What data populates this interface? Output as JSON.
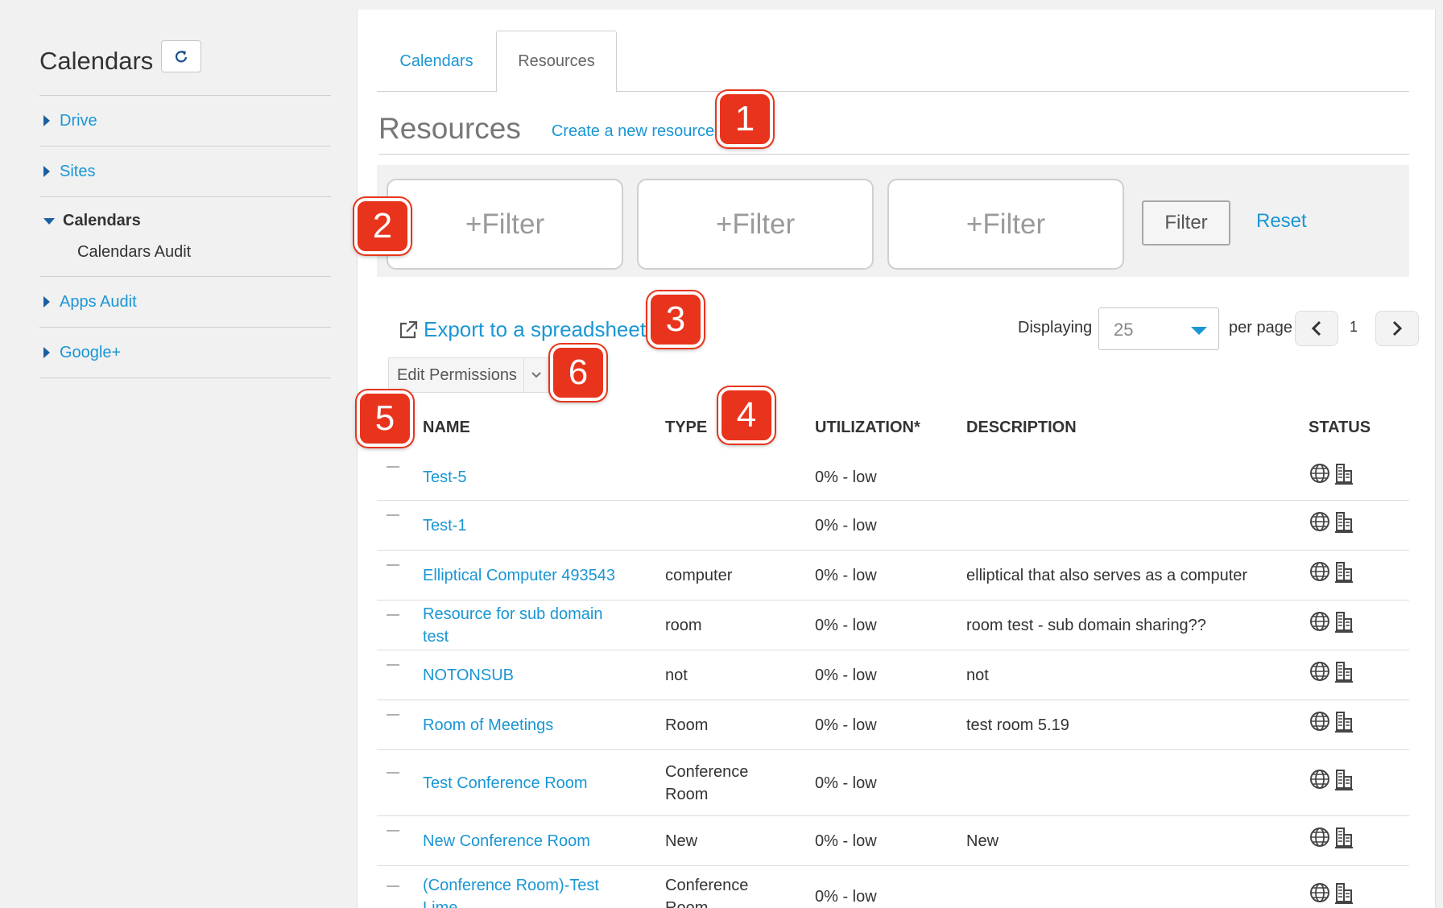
{
  "sidebar": {
    "title": "Calendars",
    "items": [
      {
        "label": "Drive"
      },
      {
        "label": "Sites"
      },
      {
        "label": "Calendars",
        "sub": "Calendars Audit"
      },
      {
        "label": "Apps Audit"
      },
      {
        "label": "Google+"
      }
    ]
  },
  "tabs": [
    {
      "label": "Calendars",
      "active": false
    },
    {
      "label": "Resources",
      "active": true
    }
  ],
  "resources": {
    "title": "Resources",
    "create_link": "Create a new resource"
  },
  "filters": {
    "boxes": [
      "+Filter",
      "+Filter",
      "+Filter"
    ],
    "filter_button": "Filter",
    "reset_link": "Reset"
  },
  "export_link": "Export to a spreadsheet",
  "pager": {
    "displaying_label": "Displaying",
    "per_page_value": "25",
    "per_page_label": "per page",
    "page": "1"
  },
  "edit_permissions": "Edit Permissions",
  "table": {
    "headers": [
      "NAME",
      "TYPE",
      "UTILIZATION*",
      "DESCRIPTION",
      "STATUS"
    ],
    "rows": [
      {
        "name": "Test-5",
        "type": "",
        "utilization": "0% - low",
        "description": ""
      },
      {
        "name": "Test-1",
        "type": "",
        "utilization": "0% - low",
        "description": ""
      },
      {
        "name": "Elliptical Computer 493543",
        "type": "computer",
        "utilization": "0% - low",
        "description": "elliptical that also serves as a computer"
      },
      {
        "name": "Resource for sub domain test",
        "type": "room",
        "utilization": "0% - low",
        "description": "room test - sub domain sharing??"
      },
      {
        "name": "NOTONSUB",
        "type": "not",
        "utilization": "0% - low",
        "description": "not"
      },
      {
        "name": "Room of Meetings",
        "type": "Room",
        "utilization": "0% - low",
        "description": "test room 5.19"
      },
      {
        "name": "Test Conference Room",
        "type": "Conference Room",
        "utilization": "0% - low",
        "description": ""
      },
      {
        "name": "New Conference Room",
        "type": "New",
        "utilization": "0% - low",
        "description": "New"
      },
      {
        "name": "(Conference Room)-Test Lime...",
        "type": "Conference Room",
        "utilization": "0% - low",
        "description": ""
      }
    ]
  },
  "callouts": [
    "1",
    "2",
    "3",
    "4",
    "5",
    "6"
  ],
  "colors": {
    "link": "#1a96d4",
    "callout": "#e8341c"
  }
}
